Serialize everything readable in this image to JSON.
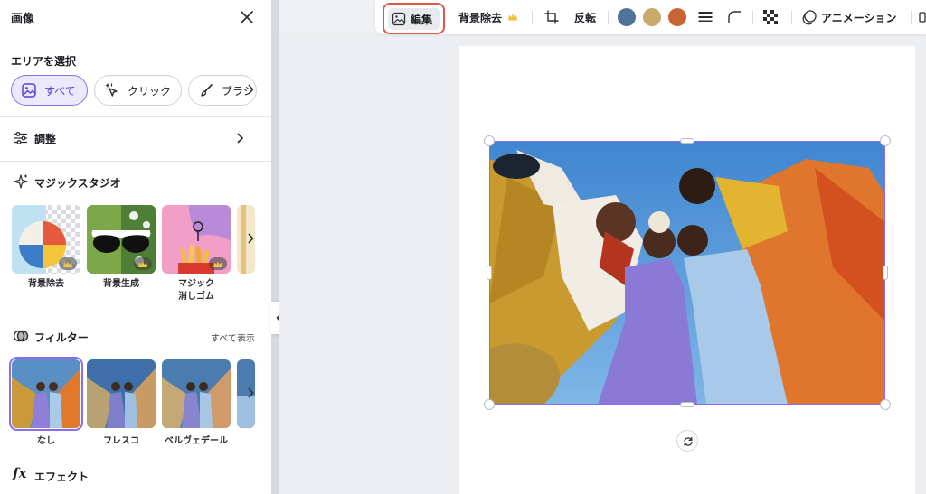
{
  "panel": {
    "title": "画像",
    "area": {
      "label": "エリアを選択",
      "chips": [
        {
          "label": "すべて",
          "selected": true
        },
        {
          "label": "クリック",
          "selected": false
        },
        {
          "label": "ブラシ",
          "selected": false
        }
      ]
    },
    "adjust": {
      "label": "調整"
    },
    "magic_studio": {
      "label": "マジックスタジオ",
      "tools": [
        {
          "caption": "背景除去",
          "premium": true
        },
        {
          "caption": "背景生成",
          "premium": true
        },
        {
          "caption": "マジック\n消しゴム",
          "premium": true
        }
      ]
    },
    "filters": {
      "label": "フィルター",
      "see_all": "すべて表示",
      "items": [
        {
          "caption": "なし",
          "selected": true
        },
        {
          "caption": "フレスコ",
          "selected": false
        },
        {
          "caption": "ベルヴェデール",
          "selected": false
        }
      ]
    },
    "effects": {
      "label": "エフェクト",
      "icon_text": "fx"
    }
  },
  "toolbar": {
    "edit_label": "編集",
    "bg_remove_label": "背景除去",
    "flip_label": "反転",
    "animate_label": "アニメーション",
    "colors": [
      "#4f7399",
      "#c8ab6c",
      "#c96432"
    ]
  },
  "icons": {
    "close": "close-icon",
    "image": "image-icon",
    "click": "cursor-sparkle-icon",
    "brush": "brush-icon",
    "sliders": "sliders-icon",
    "sparkle": "sparkle-icon",
    "filter": "filter-circles-icon",
    "crown": "crown-icon",
    "crop": "crop-icon",
    "rotate": "rotate-icon"
  }
}
